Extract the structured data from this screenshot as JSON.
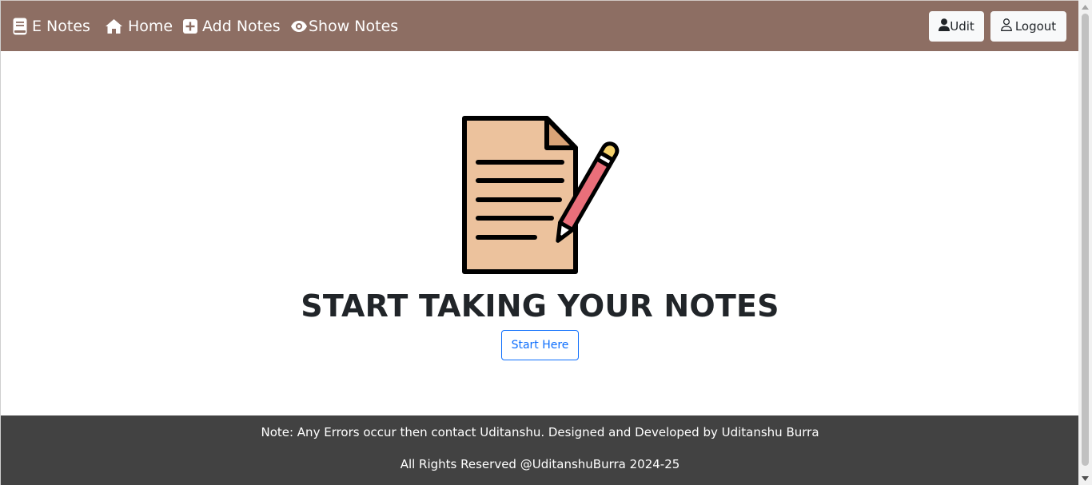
{
  "navbar": {
    "brand": {
      "label": "E Notes",
      "icon": "book-icon"
    },
    "links": [
      {
        "label": "Home",
        "icon": "home-icon"
      },
      {
        "label": "Add Notes",
        "icon": "plus-square-icon"
      },
      {
        "label": "Show Notes",
        "icon": "eye-icon"
      }
    ],
    "user_button": {
      "label": "Udit",
      "icon": "user-icon"
    },
    "logout_button": {
      "label": "Logout",
      "icon": "user-outline-icon"
    },
    "colors": {
      "background": "#8d6e63"
    }
  },
  "hero": {
    "illustration": "notes-pencil-illustration",
    "title": "START TAKING YOUR NOTES",
    "button_label": "Start Here",
    "colors": {
      "button": "#0d6efd",
      "paper": "#ecc29d",
      "pencil": "#ea6f7a"
    }
  },
  "footer": {
    "line1": "Note: Any Errors occur then contact Uditanshu. Designed and Developed by Uditanshu Burra",
    "line2": "All Rights Reserved @UditanshuBurra 2024-25",
    "colors": {
      "background": "#424242"
    }
  }
}
